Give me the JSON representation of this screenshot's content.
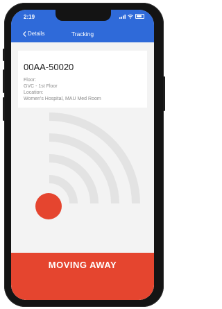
{
  "status_bar": {
    "time": "2:19"
  },
  "nav": {
    "back_label": "Details",
    "title": "Tracking"
  },
  "asset": {
    "id": "00AA-50020",
    "floor_label": "Floor:",
    "floor_value": "GVC - 1st Floor",
    "location_label": "Location:",
    "location_value": "Women's Hospital, MAU Med Room"
  },
  "proximity": {
    "status_label": "MOVING AWAY",
    "status_color": "#e5452f",
    "signal_color": "#e3e3e3",
    "dot_color": "#e5452f"
  },
  "colors": {
    "header": "#2f6ad9"
  },
  "icons": {
    "back": "chevron-left-icon",
    "cellular": "cellular-signal-icon",
    "wifi": "wifi-icon",
    "battery": "battery-icon",
    "proximity": "wifi-signal-icon"
  }
}
